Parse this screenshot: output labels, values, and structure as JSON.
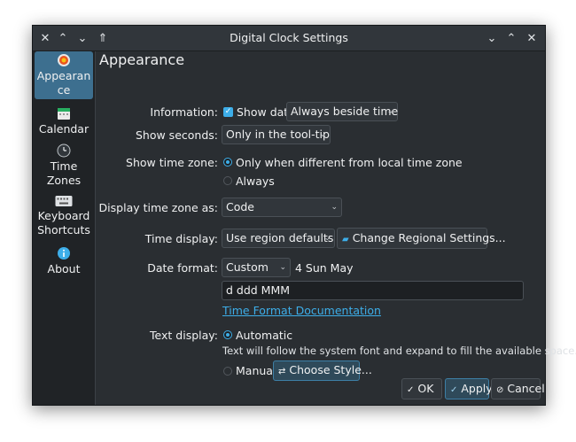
{
  "window": {
    "title": "Digital Clock Settings"
  },
  "sidebar": {
    "items": [
      {
        "label_line1": "Appearan",
        "label_line2": "ce",
        "icon": "appearance-icon"
      },
      {
        "label_line1": "Calendar",
        "icon": "calendar-icon"
      },
      {
        "label_line1": "Time",
        "label_line2": "Zones",
        "icon": "clock-icon"
      },
      {
        "label_line1": "Keyboard",
        "label_line2": "Shortcuts",
        "icon": "keyboard-icon"
      },
      {
        "label_line1": "About",
        "icon": "info-icon"
      }
    ]
  },
  "page": {
    "title": "Appearance",
    "information_label": "Information:",
    "show_date_label": "Show date",
    "show_date_mode": "Always beside time",
    "show_seconds_label": "Show seconds:",
    "show_seconds_value": "Only in the tool-tip",
    "show_timezone_label": "Show time zone:",
    "tz_option_1": "Only when different from local time zone",
    "tz_option_2": "Always",
    "display_tz_label": "Display time zone as:",
    "display_tz_value": "Code",
    "time_display_label": "Time display:",
    "time_display_value": "Use region defaults",
    "change_regional_label": "Change Regional Settings...",
    "date_format_label": "Date format:",
    "date_format_value": "Custom",
    "date_preview": "4 Sun May",
    "date_format_text": "d ddd MMM",
    "time_format_doc_link": "Time Format Documentation",
    "text_display_label": "Text display:",
    "text_auto_label": "Automatic",
    "text_auto_hint": "Text will follow the system font and expand to fill the available space.",
    "text_manual_label": "Manual",
    "choose_style_label": "Choose Style..."
  },
  "buttons": {
    "ok": "OK",
    "apply": "Apply",
    "cancel": "Cancel"
  },
  "colors": {
    "accent": "#3daee9",
    "window_bg": "#2a2e32",
    "sidebar_bg": "#202326",
    "selected": "#3d6f8f"
  }
}
